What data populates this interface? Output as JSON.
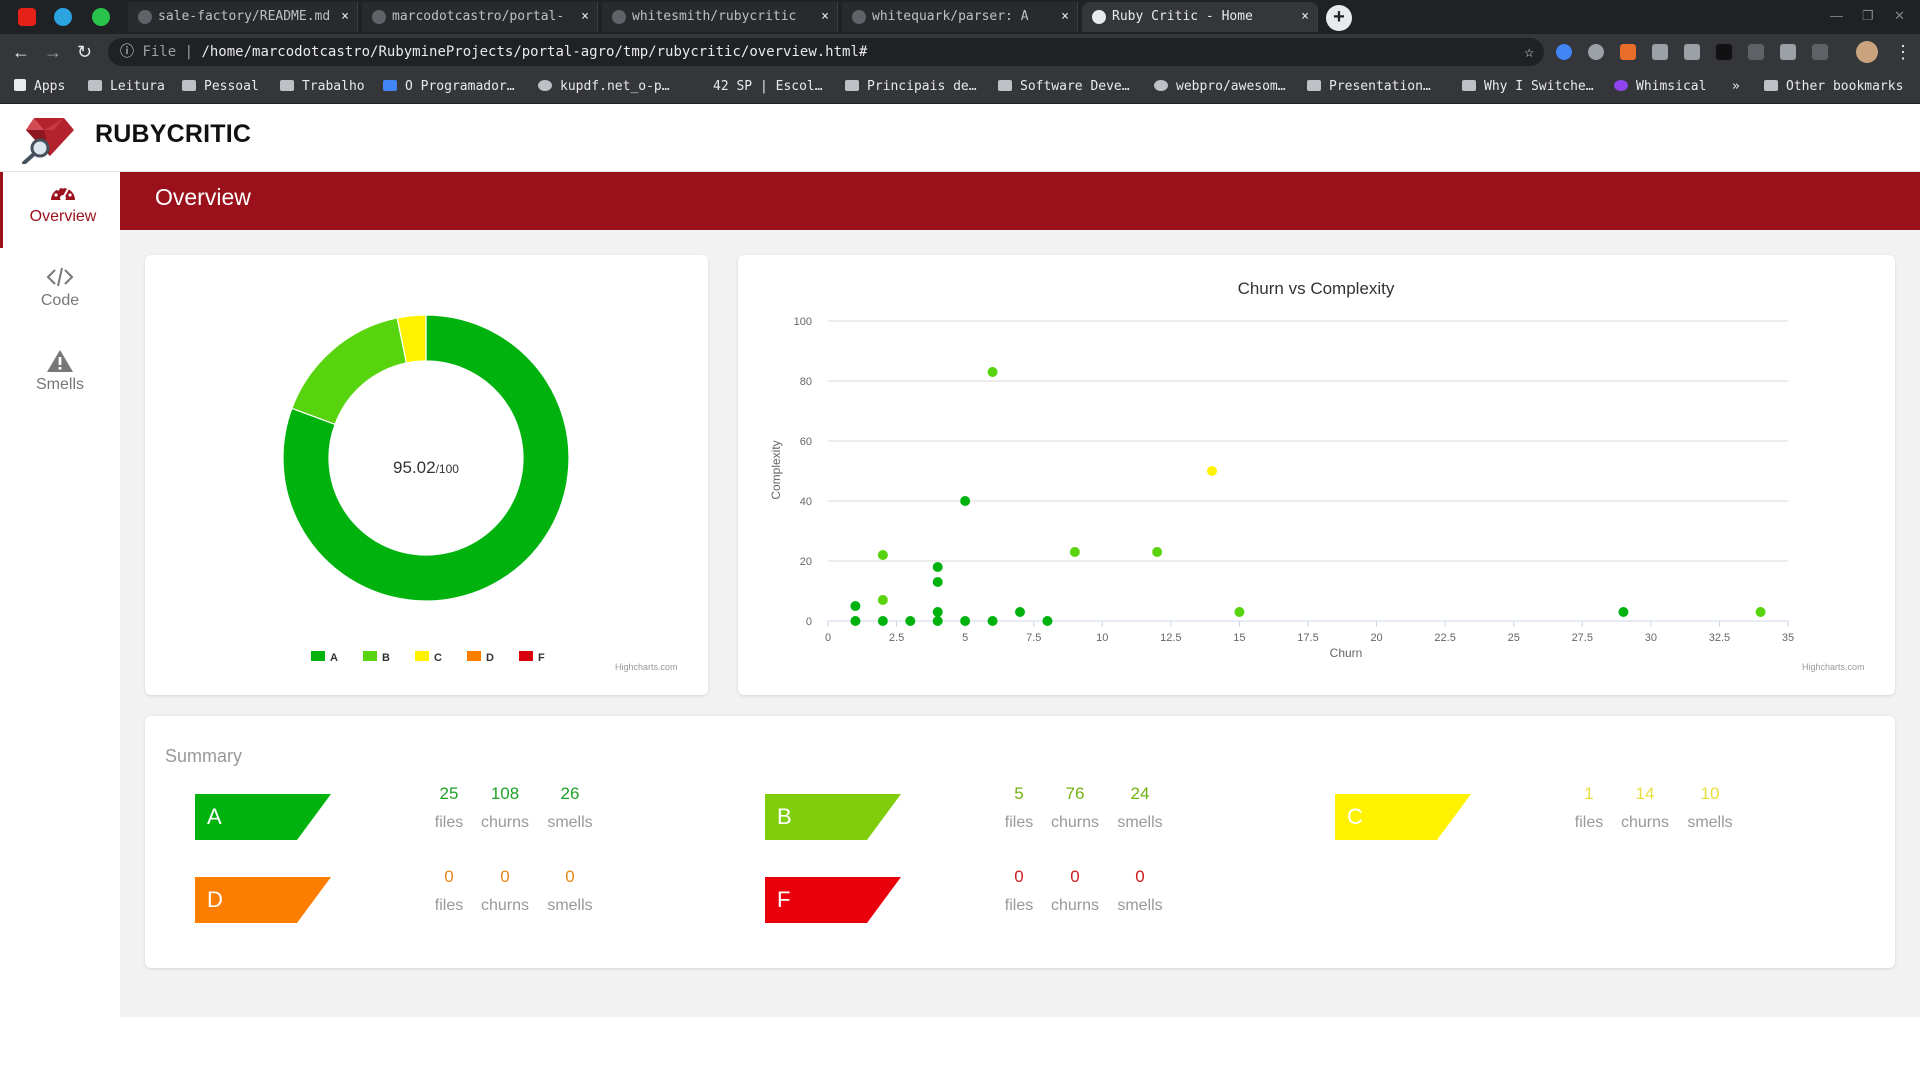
{
  "browser": {
    "tabs": [
      {
        "title": "sale-factory/README.md",
        "active": false
      },
      {
        "title": "marcodotcastro/portal-",
        "active": false
      },
      {
        "title": "whitesmith/rubycritic",
        "active": false
      },
      {
        "title": "whitequark/parser: A",
        "active": false
      },
      {
        "title": "Ruby Critic - Home",
        "active": true
      }
    ],
    "tab_close": "×",
    "new_tab": "+",
    "url_scheme": "File",
    "url": "/home/marcodotcastro/RubymineProjects/portal-agro/tmp/rubycritic/overview.html#",
    "bookmarks": [
      "Apps",
      "Leitura",
      "Pessoal",
      "Trabalho",
      "O Programador…",
      "kupdf.net_o-p…",
      "42 SP | Escol…",
      "Principais de…",
      "Software Deve…",
      "webpro/awesom…",
      "Presentation…",
      "Why I Switche…",
      "Whimsical",
      "»",
      "Other bookmarks"
    ]
  },
  "app": {
    "brand": "RUBYCRITIC",
    "sidebar": [
      {
        "label": "Overview",
        "icon": "gauge-icon",
        "active": true
      },
      {
        "label": "Code",
        "icon": "code-icon",
        "active": false
      },
      {
        "label": "Smells",
        "icon": "warning-icon",
        "active": false
      }
    ],
    "page_title": "Overview",
    "score": {
      "value": "95.02",
      "max": "/100"
    },
    "credit": "Highcharts.com",
    "colors": {
      "A": "#00b20e",
      "B": "#58d40e",
      "C": "#fff200",
      "D": "#fd7d00",
      "F": "#d8000c",
      "brand": "#9a111b"
    }
  },
  "chart_data": [
    {
      "type": "pie",
      "title": "",
      "labels": [
        "A",
        "B",
        "C",
        "D",
        "F"
      ],
      "values": [
        25,
        5,
        1,
        0,
        0
      ],
      "colors": [
        "#00b20e",
        "#58d40e",
        "#fff200",
        "#fd7d00",
        "#d8000c"
      ],
      "legend": "bottom"
    },
    {
      "type": "scatter",
      "title": "Churn vs Complexity",
      "xlabel": "Churn",
      "ylabel": "Complexity",
      "xlim": [
        0,
        35
      ],
      "ylim": [
        0,
        100
      ],
      "xticks": [
        "0",
        "2.5",
        "5",
        "7.5",
        "10",
        "12.5",
        "15",
        "17.5",
        "20",
        "22.5",
        "25",
        "27.5",
        "30",
        "32.5",
        "35"
      ],
      "yticks": [
        "0",
        "20",
        "40",
        "60",
        "80",
        "100"
      ],
      "grid": true,
      "points": [
        {
          "x": 6,
          "y": 83,
          "grade": "B"
        },
        {
          "x": 14,
          "y": 50,
          "grade": "C"
        },
        {
          "x": 5,
          "y": 40,
          "grade": "A"
        },
        {
          "x": 2,
          "y": 22,
          "grade": "B"
        },
        {
          "x": 9,
          "y": 23,
          "grade": "B"
        },
        {
          "x": 12,
          "y": 23,
          "grade": "B"
        },
        {
          "x": 4,
          "y": 18,
          "grade": "A"
        },
        {
          "x": 4,
          "y": 13,
          "grade": "A"
        },
        {
          "x": 1,
          "y": 5,
          "grade": "A"
        },
        {
          "x": 2,
          "y": 7,
          "grade": "B"
        },
        {
          "x": 4,
          "y": 3,
          "grade": "A"
        },
        {
          "x": 7,
          "y": 3,
          "grade": "A"
        },
        {
          "x": 15,
          "y": 3,
          "grade": "B"
        },
        {
          "x": 29,
          "y": 3,
          "grade": "A"
        },
        {
          "x": 34,
          "y": 3,
          "grade": "B"
        },
        {
          "x": 1,
          "y": 0,
          "grade": "A"
        },
        {
          "x": 2,
          "y": 0,
          "grade": "A"
        },
        {
          "x": 3,
          "y": 0,
          "grade": "A"
        },
        {
          "x": 4,
          "y": 0,
          "grade": "A"
        },
        {
          "x": 5,
          "y": 0,
          "grade": "A"
        },
        {
          "x": 6,
          "y": 0,
          "grade": "A"
        },
        {
          "x": 8,
          "y": 0,
          "grade": "A"
        }
      ]
    }
  ],
  "summary": {
    "title": "Summary",
    "units": {
      "files": "files",
      "churns": "churns",
      "smells": "smells"
    },
    "grades": [
      {
        "grade": "A",
        "files": "25",
        "churns": "108",
        "smells": "26",
        "color": "#00b20e",
        "text_color": "#1ea127"
      },
      {
        "grade": "B",
        "files": "5",
        "churns": "76",
        "smells": "24",
        "color": "#80ce0b",
        "text_color": "#71b30e"
      },
      {
        "grade": "C",
        "files": "1",
        "churns": "14",
        "smells": "10",
        "color": "#fff200",
        "text_color": "#e8df3a"
      },
      {
        "grade": "D",
        "files": "0",
        "churns": "0",
        "smells": "0",
        "color": "#fd7d00",
        "text_color": "#e88616"
      },
      {
        "grade": "F",
        "files": "0",
        "churns": "0",
        "smells": "0",
        "color": "#e9000c",
        "text_color": "#cc1c1c"
      }
    ]
  }
}
